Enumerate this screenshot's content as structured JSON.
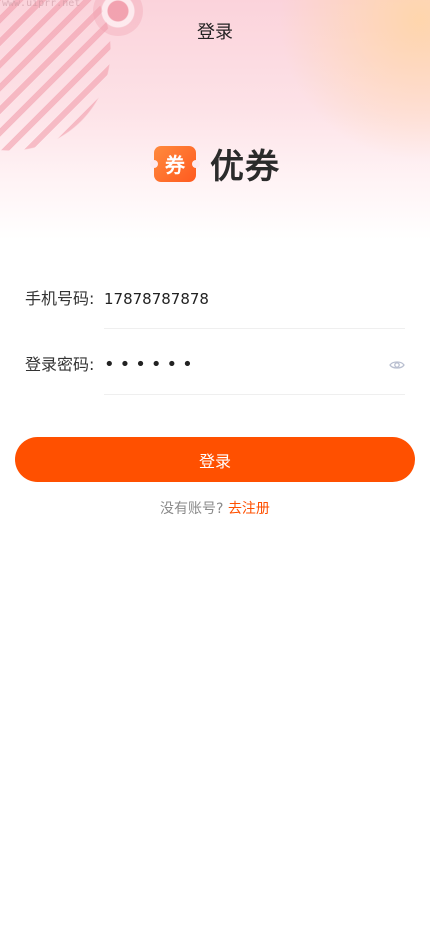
{
  "watermark": "www.uiprr.net",
  "nav": {
    "title": "登录"
  },
  "logo": {
    "badge_char": "券",
    "name": "优券"
  },
  "form": {
    "phone_label": "手机号码:",
    "phone_value": "17878787878",
    "password_label": "登录密码:",
    "password_mask": "••••••"
  },
  "actions": {
    "login_label": "登录",
    "no_account_text": "没有账号?",
    "register_link": "去注册"
  },
  "colors": {
    "accent": "#ff5000",
    "logo_gradient_start": "#ff8a3d",
    "logo_gradient_end": "#ff5a1f"
  }
}
